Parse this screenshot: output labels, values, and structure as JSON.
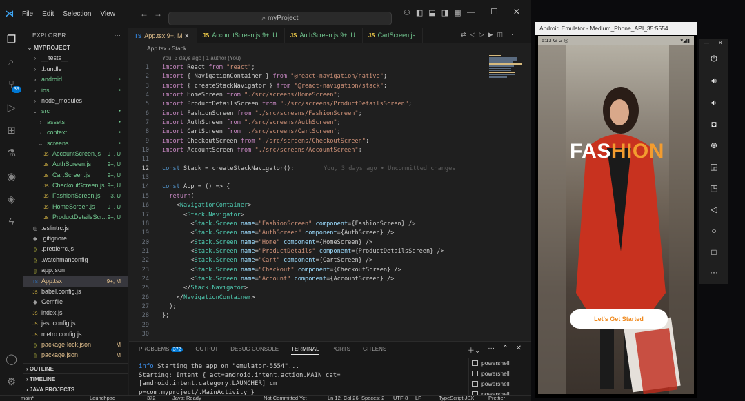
{
  "vscode": {
    "menu": [
      "File",
      "Edit",
      "Selection",
      "View"
    ],
    "search": "myProject",
    "tabs": [
      {
        "name": "App.tsx",
        "status": "9+, M",
        "kind": "tsx"
      },
      {
        "name": "AccountScreen.js",
        "status": "9+, U",
        "kind": "js"
      },
      {
        "name": "AuthScreen.js",
        "status": "9+, U",
        "kind": "js"
      },
      {
        "name": "CartScreen.js",
        "status": "",
        "kind": "js"
      }
    ],
    "breadcrumb": {
      "file": "App.tsx",
      "symbol": "Stack"
    },
    "blame": "You, 3 days ago | 1 author (You)",
    "explorer": {
      "header": "EXPLORER",
      "project": "MYPROJECT",
      "items": [
        {
          "label": "__tests__",
          "indent": 1,
          "icon": "›",
          "status": ""
        },
        {
          "label": ".bundle",
          "indent": 1,
          "icon": "›",
          "status": ""
        },
        {
          "label": "android",
          "indent": 1,
          "icon": "›",
          "status": "dot"
        },
        {
          "label": "ios",
          "indent": 1,
          "icon": "›",
          "status": "dot"
        },
        {
          "label": "node_modules",
          "indent": 1,
          "icon": "›",
          "status": ""
        },
        {
          "label": "src",
          "indent": 1,
          "icon": "⌄",
          "status": "dot"
        },
        {
          "label": "assets",
          "indent": 2,
          "icon": "›",
          "status": "dot"
        },
        {
          "label": "context",
          "indent": 2,
          "icon": "›",
          "status": "dot"
        },
        {
          "label": "screens",
          "indent": 2,
          "icon": "⌄",
          "status": "dot"
        },
        {
          "label": "AccountScreen.js",
          "indent": 3,
          "icon": "JS",
          "status": "9+, U"
        },
        {
          "label": "AuthScreen.js",
          "indent": 3,
          "icon": "JS",
          "status": "9+, U"
        },
        {
          "label": "CartScreen.js",
          "indent": 3,
          "icon": "JS",
          "status": "9+, U"
        },
        {
          "label": "CheckoutScreen.js",
          "indent": 3,
          "icon": "JS",
          "status": "9+, U"
        },
        {
          "label": "FashionScreen.js",
          "indent": 3,
          "icon": "JS",
          "status": "3, U"
        },
        {
          "label": "HomeScreen.js",
          "indent": 3,
          "icon": "JS",
          "status": "9+, U"
        },
        {
          "label": "ProductDetailsScr...",
          "indent": 3,
          "icon": "JS",
          "status": "9+, U"
        },
        {
          "label": ".eslintrc.js",
          "indent": 1,
          "icon": "◎",
          "status": ""
        },
        {
          "label": ".gitignore",
          "indent": 1,
          "icon": "◆",
          "status": ""
        },
        {
          "label": ".prettierrc.js",
          "indent": 1,
          "icon": "{}",
          "status": ""
        },
        {
          "label": ".watchmanconfig",
          "indent": 1,
          "icon": "{}",
          "status": ""
        },
        {
          "label": "app.json",
          "indent": 1,
          "icon": "{}",
          "status": ""
        },
        {
          "label": "App.tsx",
          "indent": 1,
          "icon": "TS",
          "status": "9+, M"
        },
        {
          "label": "babel.config.js",
          "indent": 1,
          "icon": "JS",
          "status": ""
        },
        {
          "label": "Gemfile",
          "indent": 1,
          "icon": "◆",
          "status": ""
        },
        {
          "label": "index.js",
          "indent": 1,
          "icon": "JS",
          "status": ""
        },
        {
          "label": "jest.config.js",
          "indent": 1,
          "icon": "JS",
          "status": ""
        },
        {
          "label": "metro.config.js",
          "indent": 1,
          "icon": "JS",
          "status": ""
        },
        {
          "label": "package-lock.json",
          "indent": 1,
          "icon": "{}",
          "status": "M"
        },
        {
          "label": "package.json",
          "indent": 1,
          "icon": "{}",
          "status": "M"
        }
      ],
      "sections": [
        "OUTLINE",
        "TIMELINE",
        "JAVA PROJECTS"
      ]
    },
    "code": [
      {
        "n": "1",
        "t": "import React from \"react\";"
      },
      {
        "n": "2",
        "t": "import { NavigationContainer } from \"@react-navigation/native\";"
      },
      {
        "n": "3",
        "t": "import { createStackNavigator } from \"@react-navigation/stack\";"
      },
      {
        "n": "4",
        "t": "import HomeScreen from \"./src/screens/HomeScreen\";"
      },
      {
        "n": "5",
        "t": "import ProductDetailsScreen from \"./src/screens/ProductDetailsScreen\";"
      },
      {
        "n": "6",
        "t": "import FashionScreen from \"./src/screens/FashionScreen\";"
      },
      {
        "n": "7",
        "t": "import AuthScreen from \"./src/screens/AuthScreen\";"
      },
      {
        "n": "8",
        "t": "import CartScreen from './src/screens/CartScreen';"
      },
      {
        "n": "9",
        "t": "import CheckoutScreen from \"./src/screens/CheckoutScreen\";"
      },
      {
        "n": "10",
        "t": "import AccountScreen from \"./src/screens/AccountScreen\";"
      },
      {
        "n": "11",
        "t": ""
      },
      {
        "n": "12",
        "t": "const Stack = createStackNavigator();"
      },
      {
        "n": "13",
        "t": ""
      },
      {
        "n": "14",
        "t": "const App = () => {"
      },
      {
        "n": "15",
        "t": "  return("
      },
      {
        "n": "16",
        "t": "    <NavigationContainer>"
      },
      {
        "n": "17",
        "t": "      <Stack.Navigator>"
      },
      {
        "n": "18",
        "t": "        <Stack.Screen name=\"FashionScreen\" component={FashionScreen} />"
      },
      {
        "n": "19",
        "t": "        <Stack.Screen name=\"AuthScreen\" component={AuthScreen} />"
      },
      {
        "n": "20",
        "t": "        <Stack.Screen name=\"Home\" component={HomeScreen} />"
      },
      {
        "n": "21",
        "t": "        <Stack.Screen name=\"ProductDetails\" component={ProductDetailsScreen} />"
      },
      {
        "n": "22",
        "t": "        <Stack.Screen name=\"Cart\" component={CartScreen} />"
      },
      {
        "n": "23",
        "t": "        <Stack.Screen name=\"Checkout\" component={CheckoutScreen} />"
      },
      {
        "n": "24",
        "t": "        <Stack.Screen name=\"Account\" component={AccountScreen} />"
      },
      {
        "n": "25",
        "t": "      </Stack.Navigator>"
      },
      {
        "n": "26",
        "t": "    </NavigationContainer>"
      },
      {
        "n": "27",
        "t": "  );"
      },
      {
        "n": "28",
        "t": "};"
      },
      {
        "n": "29",
        "t": ""
      },
      {
        "n": "30",
        "t": ""
      }
    ],
    "current_line": "12",
    "inline_blame": "You, 3 days ago • Uncommitted changes",
    "panel": {
      "tabs": [
        "PROBLEMS",
        "OUTPUT",
        "DEBUG CONSOLE",
        "TERMINAL",
        "PORTS",
        "GITLENS"
      ],
      "active_tab": "TERMINAL",
      "problems_count": "372",
      "terminal": [
        {
          "prefix": "info",
          "text": " Starting the app on \"emulator-5554\"..."
        },
        {
          "prefix": "",
          "text": "Starting: Intent { act=android.intent.action.MAIN cat=[android.intent.category.LAUNCHER] cm"
        },
        {
          "prefix": "",
          "text": "p=com.myproject/.MainActivity }"
        }
      ],
      "shells": [
        "powershell",
        "powershell",
        "powershell",
        "powershell"
      ]
    },
    "status": {
      "branch": "main*",
      "problems": "372",
      "launchpad": "Launchpad",
      "java": "Java: Ready",
      "git": "Not Committed Yet",
      "pos": "Ln 12, Col 26",
      "spaces": "Spaces: 2",
      "encoding": "UTF-8",
      "eol": "LF",
      "lang": "TypeScript JSX",
      "prettier": "Prettier"
    },
    "activity_badge": "39"
  },
  "emulator": {
    "title": "Android Emulator - Medium_Phone_API_35:5554",
    "time": "5:13",
    "status_icons": "G G ◎",
    "hero": {
      "word_a": "FAS",
      "word_b": "HION"
    },
    "cta": "Let's Get Started",
    "accent": "#f39c2f"
  }
}
